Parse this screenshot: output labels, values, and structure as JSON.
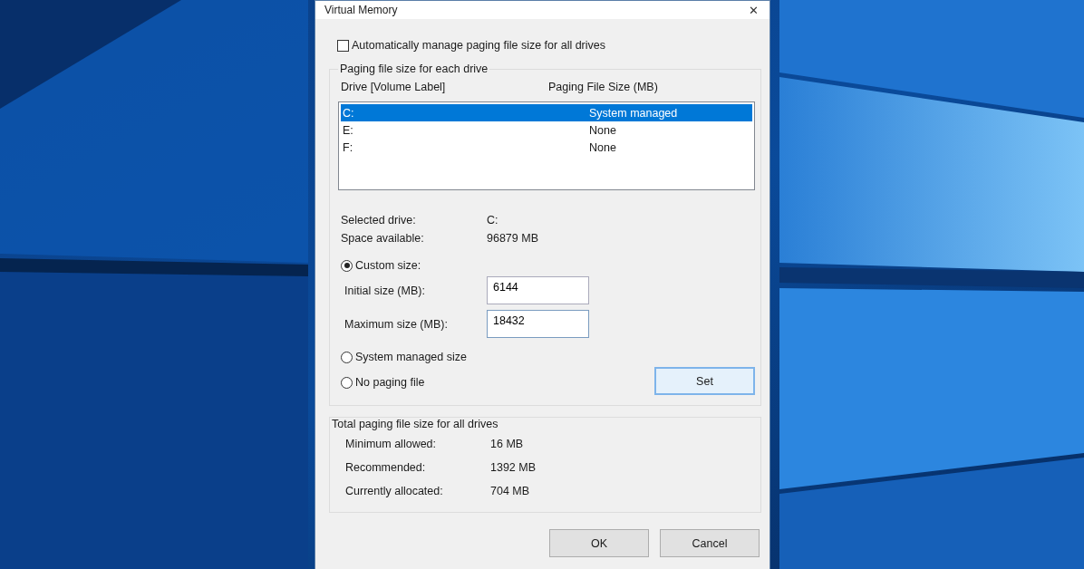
{
  "window": {
    "title": "Virtual Memory",
    "close": "✕"
  },
  "auto_manage": {
    "label": "Automatically manage paging file size for all drives",
    "checked": false
  },
  "drive_group": {
    "title": "Paging file size for each drive",
    "columns": [
      "Drive  [Volume Label]",
      "Paging File Size (MB)"
    ],
    "drives": [
      {
        "drive": "C:",
        "size": "System managed",
        "selected": true
      },
      {
        "drive": "E:",
        "size": "None",
        "selected": false
      },
      {
        "drive": "F:",
        "size": "None",
        "selected": false
      }
    ],
    "info": [
      {
        "label": "Selected drive:",
        "value": "C:"
      },
      {
        "label": "Space available:",
        "value": "96879 MB"
      }
    ],
    "options": [
      {
        "label": "Custom size:",
        "selected": true
      },
      {
        "label": "System managed size",
        "selected": false
      },
      {
        "label": "No paging file",
        "selected": false
      }
    ],
    "fields": [
      {
        "label": "Initial size (MB):",
        "value": "6144"
      },
      {
        "label": "Maximum size (MB):",
        "value": "18432"
      }
    ],
    "set_button": "Set"
  },
  "total_group": {
    "title": "Total paging file size for all drives",
    "rows": [
      {
        "label": "Minimum allowed:",
        "value": "16 MB"
      },
      {
        "label": "Recommended:",
        "value": "1392 MB"
      },
      {
        "label": "Currently allocated:",
        "value": "704 MB"
      }
    ]
  },
  "buttons": [
    "OK",
    "Cancel"
  ]
}
